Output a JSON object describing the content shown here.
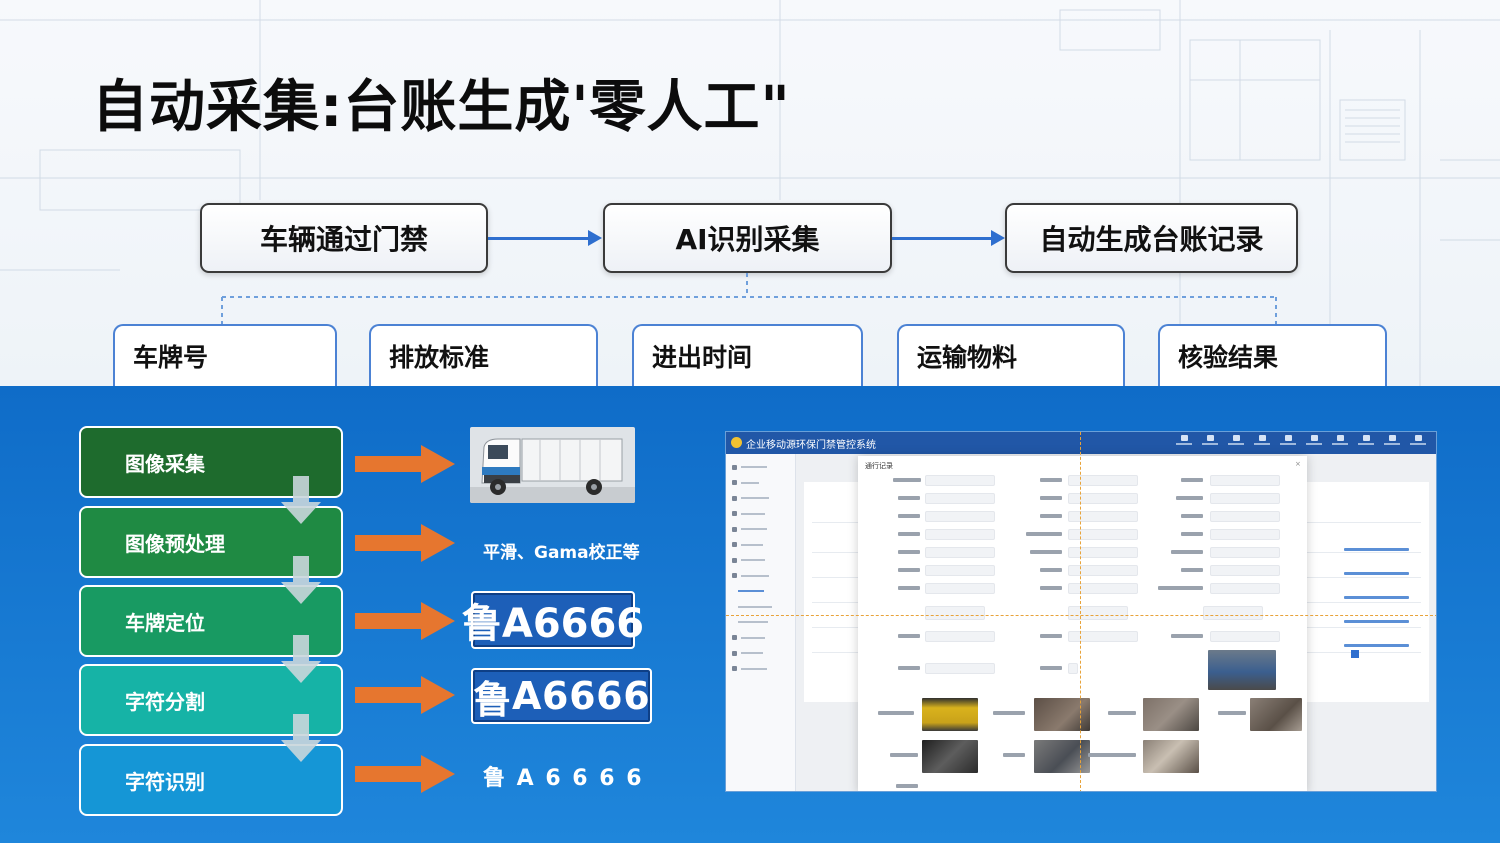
{
  "slide": {
    "title": "自动采集:台账生成'零人工\""
  },
  "flow": {
    "steps": [
      "车辆通过门禁",
      "AI识别采集",
      "自动生成台账记录"
    ]
  },
  "fields": [
    "车牌号",
    "排放标准",
    "进出时间",
    "运输物料",
    "核验结果"
  ],
  "pipeline": {
    "steps": [
      "图像采集",
      "图像预处理",
      "车牌定位",
      "字符分割",
      "字符识别"
    ],
    "step_colors": [
      "#1e6b2d",
      "#1f8a43",
      "#189a62",
      "#16b3a6",
      "#1596d6"
    ],
    "preprocess_note": "平滑、Gama校正等",
    "plate_located": "鲁A6666",
    "plate_segmented": [
      "鲁",
      "A",
      "6",
      "6",
      "6",
      "6"
    ],
    "plate_recognized": "鲁 A 6 6 6 6"
  },
  "app": {
    "system_title": "企业移动源环保门禁管控系统",
    "modal_title": "通行记录"
  },
  "colors": {
    "arrow_orange": "#e6762f",
    "flow_arrow": "#2f6fcf",
    "field_border": "#4c82d4"
  }
}
